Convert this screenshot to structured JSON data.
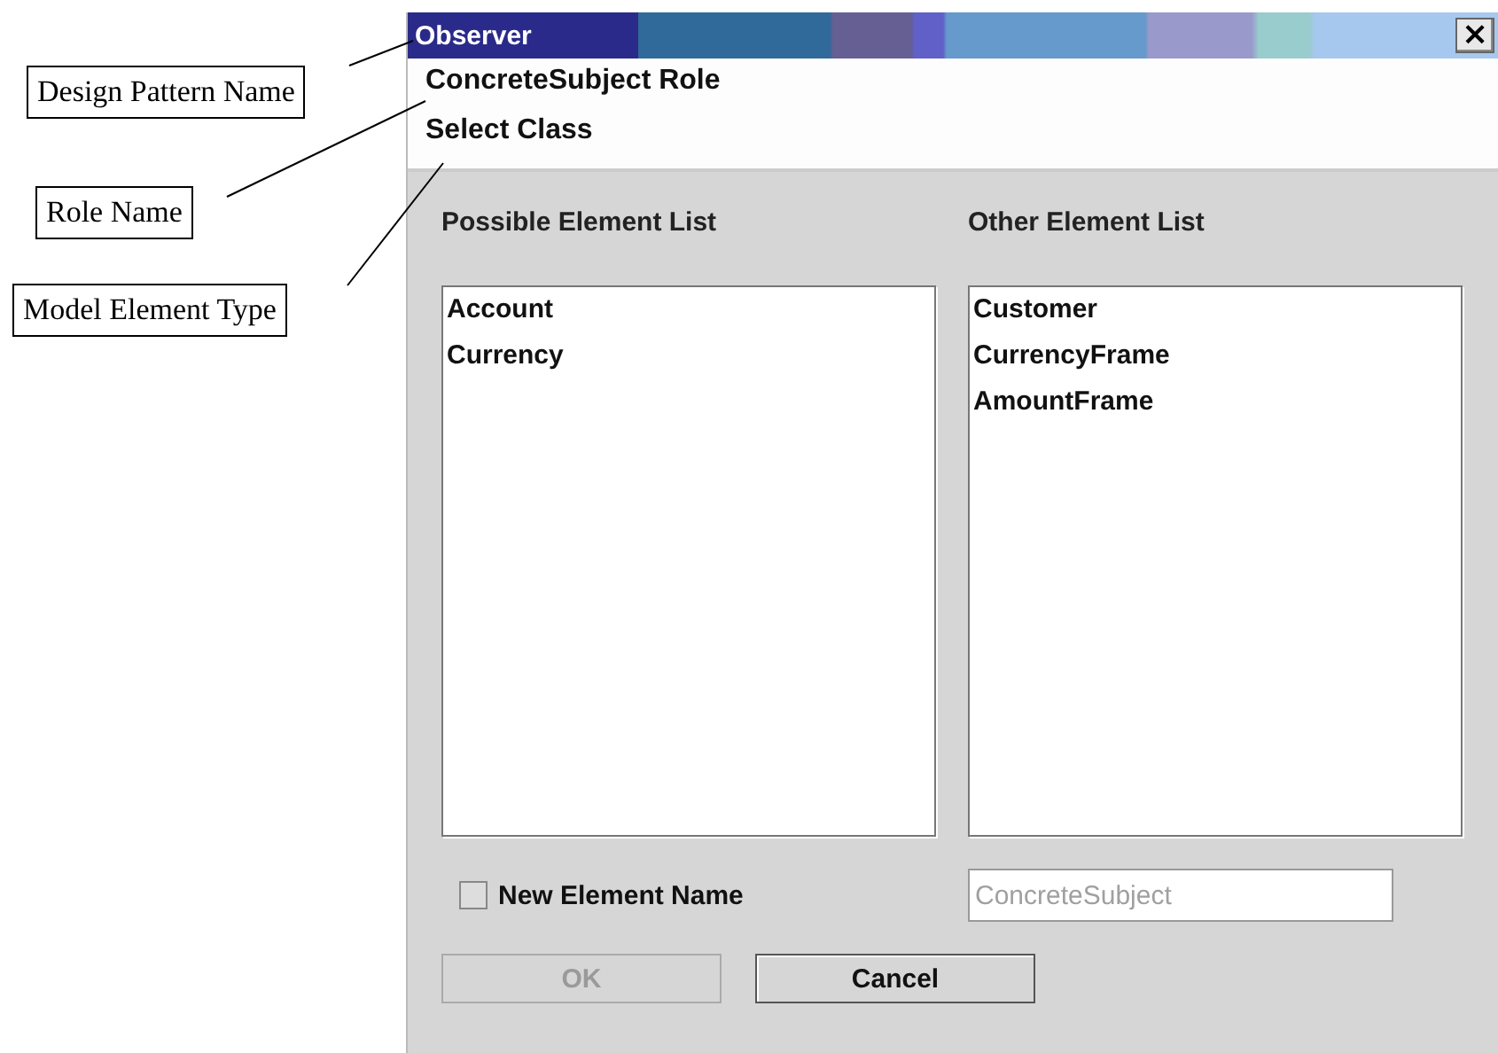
{
  "annotations": [
    {
      "text": "Design Pattern Name"
    },
    {
      "text": "Role Name"
    },
    {
      "text": "Model Element Type"
    }
  ],
  "dialog": {
    "title": "Observer",
    "close": "×",
    "role": "ConcreteSubject Role",
    "element_type": "Select Class",
    "lists": [
      {
        "label": "Possible Element List",
        "items": [
          "Account",
          "Currency"
        ]
      },
      {
        "label": "Other Element List",
        "items": [
          "Customer",
          "CurrencyFrame",
          "AmountFrame"
        ]
      }
    ],
    "new_element": {
      "label": "New Element Name",
      "checked": false
    },
    "name_field": {
      "value": "ConcreteSubject",
      "disabled": true
    },
    "buttons": [
      {
        "label": "OK",
        "disabled": true
      },
      {
        "label": "Cancel",
        "disabled": false
      }
    ]
  }
}
